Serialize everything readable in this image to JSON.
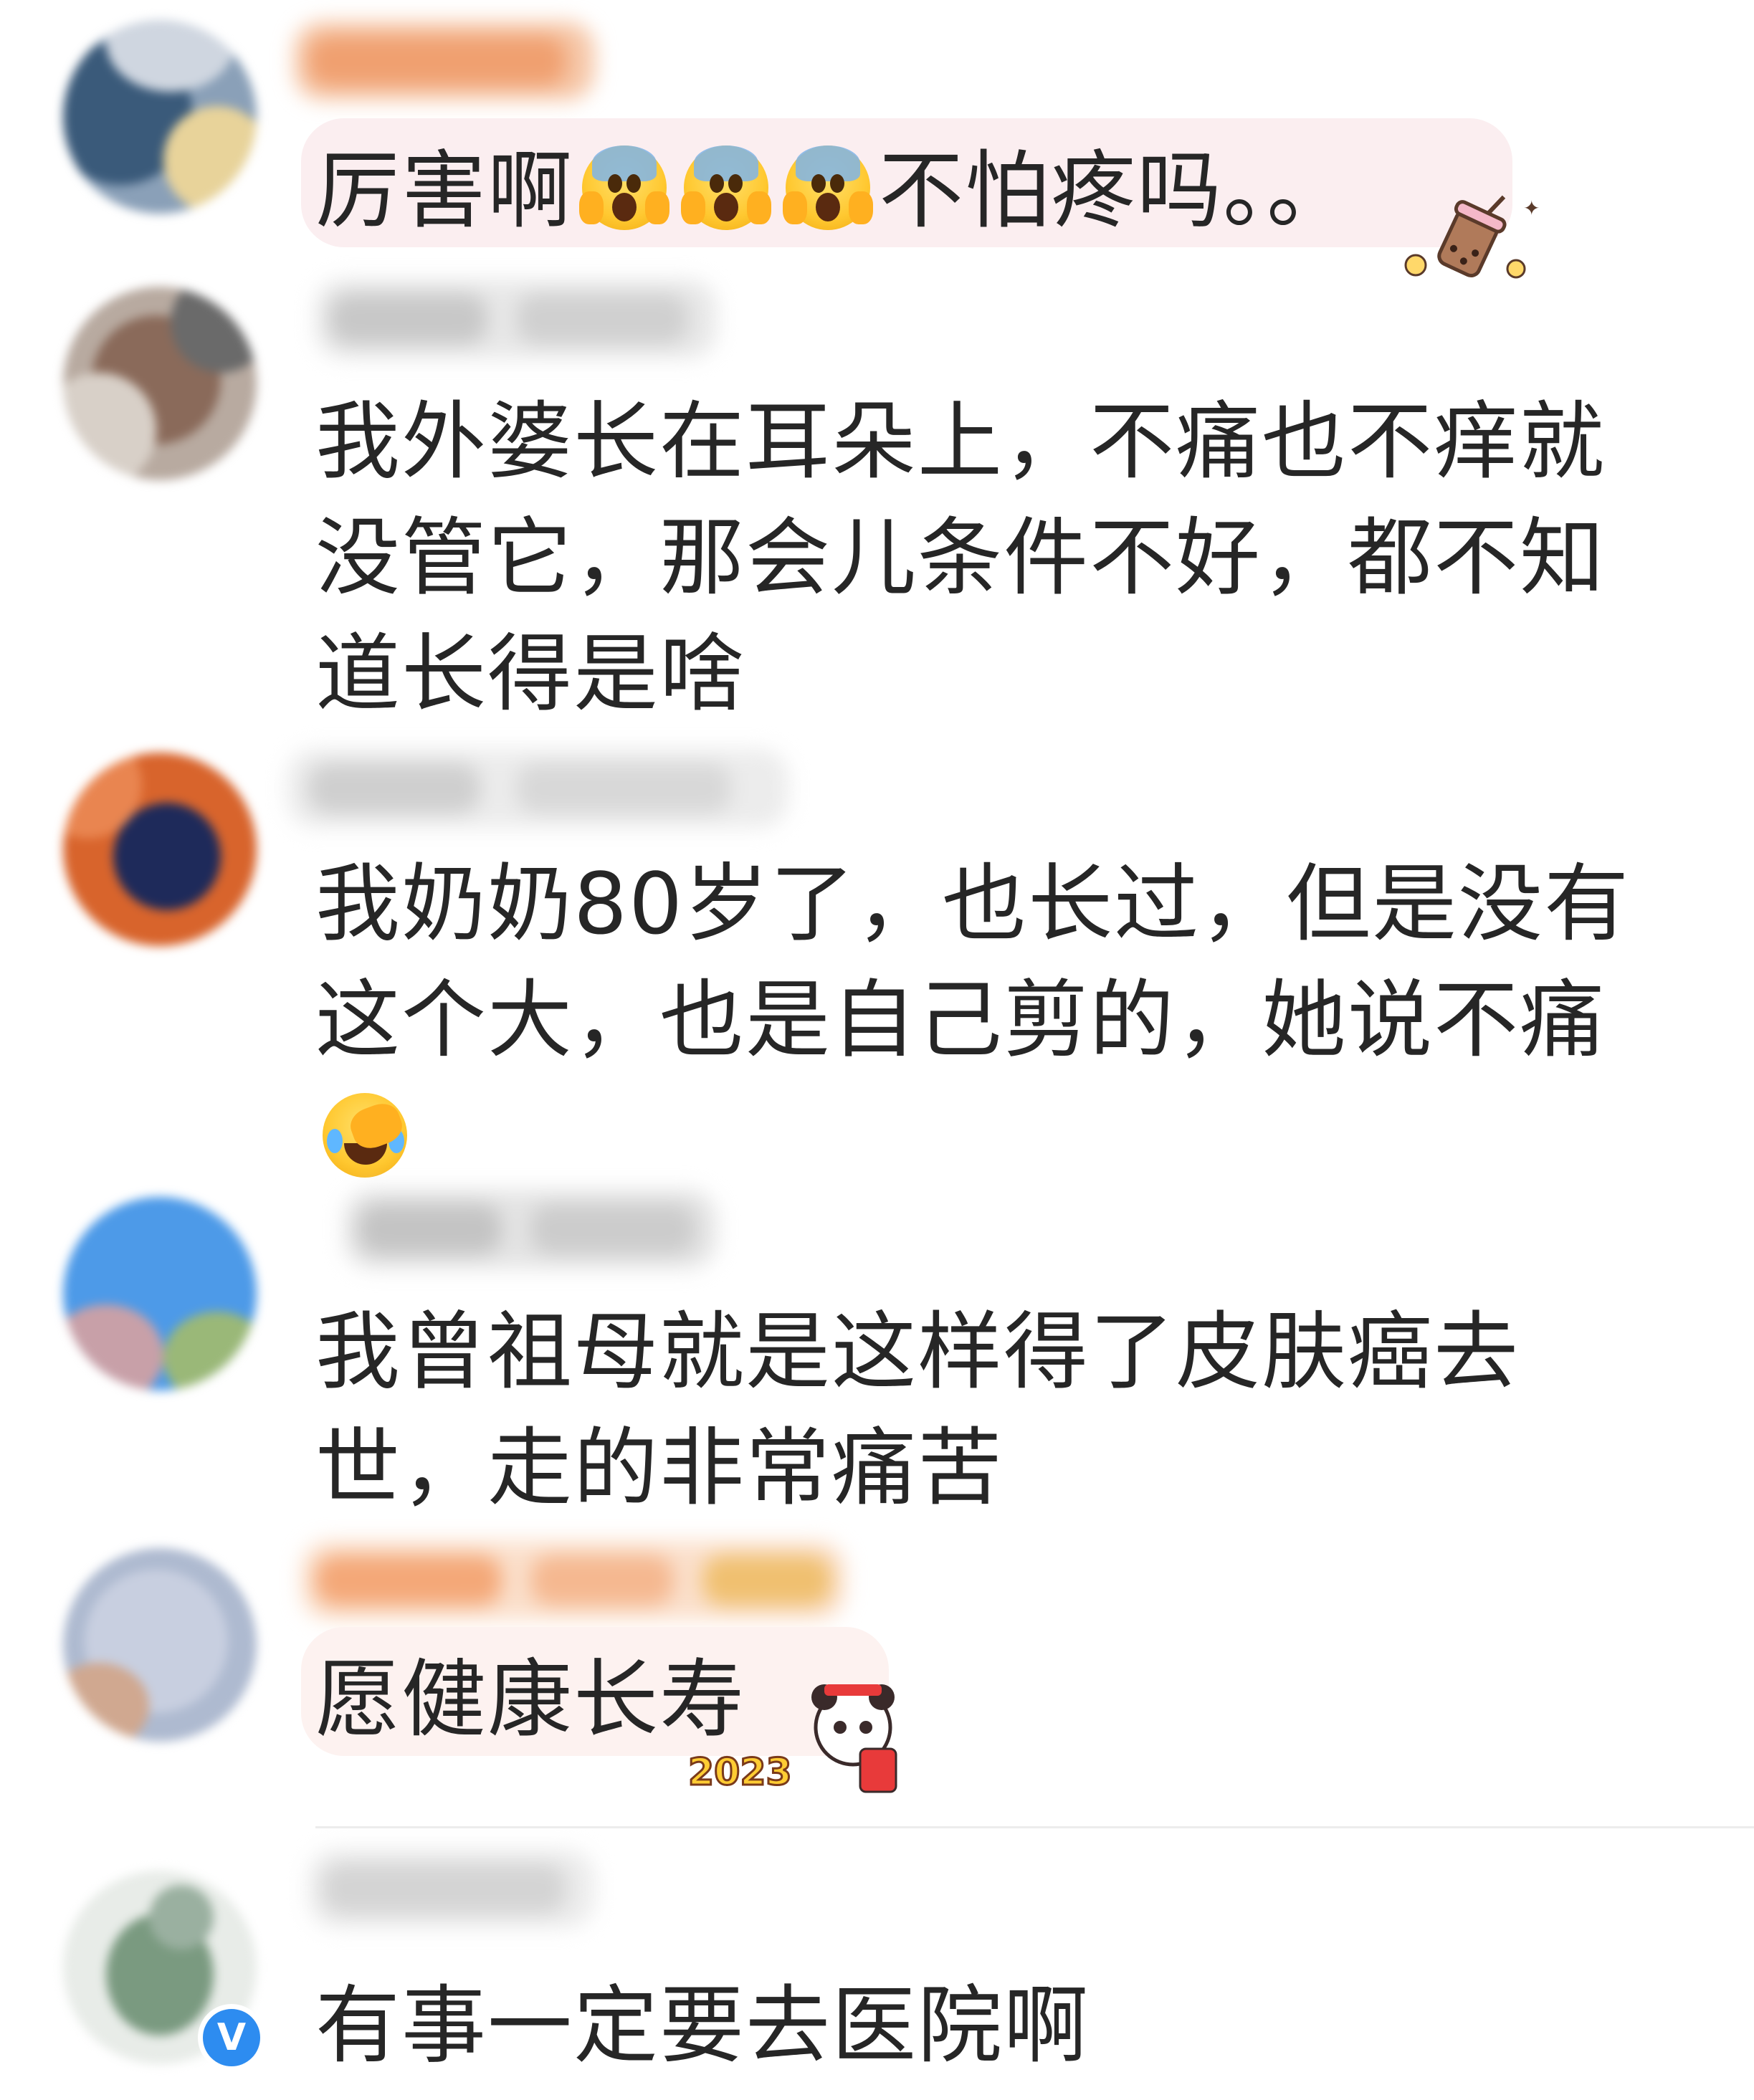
{
  "comments": [
    {
      "text_before": "厉害啊",
      "emoji_count": 3,
      "text_after": "不怕疼吗。。",
      "bubble_color": "#fbeef0"
    },
    {
      "text": "我外婆长在耳朵上，不痛也不痒就\n没管它，那会儿条件不好，都不知\n道长得是啥"
    },
    {
      "text": "我奶奶80岁了，也长过，但是没有\n这个大，也是自己剪的，她说不痛"
    },
    {
      "text": "我曾祖母就是这样得了皮肤癌去\n世，走的非常痛苦"
    },
    {
      "text": "愿健康长寿",
      "sticker_text": "2023",
      "bubble_color": "#fdf2f0"
    },
    {
      "text": "有事一定要去医院啊",
      "verified_badge": "V"
    }
  ],
  "icons": {
    "scared": "face-screaming-in-fear-icon",
    "laugh": "rolling-laughing-icon",
    "milk_tea": "milk-tea-sticker",
    "panda": "panda-2023-sticker",
    "verified": "verified-v-icon"
  },
  "colors": {
    "text": "#262626",
    "verified": "#2d8cf0",
    "divider": "#ececec"
  }
}
